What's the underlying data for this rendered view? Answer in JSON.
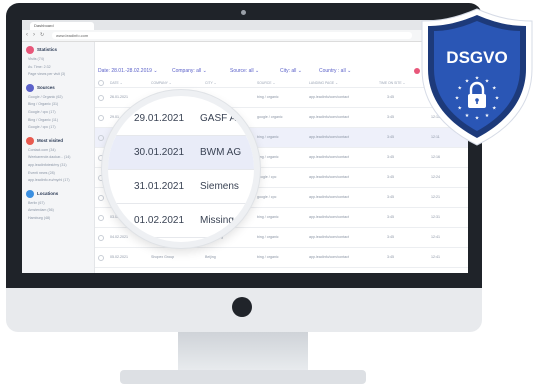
{
  "browser": {
    "tab_title": "Dashboard",
    "url": "www.leadinfo.com",
    "nav_back": "‹",
    "nav_forward": "›",
    "nav_reload": "↻"
  },
  "sidebar": {
    "sections": [
      {
        "title": "Statistics",
        "color": "#e8577a",
        "items": [
          "Visits (74)",
          "Av. Time: 2:32",
          "Page views per visit (3)"
        ]
      },
      {
        "title": "Sources",
        "color": "#5b61c9",
        "items": [
          "Google / Organic (62)",
          "Bing / Organic (31)",
          "Google / cpc (17)",
          "Bing / Organic (11)",
          "Google / cpc (17)"
        ]
      },
      {
        "title": "Most visited",
        "color": "#e85a4f",
        "items": [
          "Contact.com (34)",
          "Weekarende.daokar... (14)",
          "app.leadinfotest/my (31)",
          "Eventi news (28)",
          "app.leadinfo.eu/my/nl (17)"
        ]
      },
      {
        "title": "Locations",
        "color": "#3b8fe0",
        "items": [
          "Berlin (67)",
          "Amsterdam (56)",
          "Hamburg (48)"
        ]
      }
    ]
  },
  "filters": {
    "date": "Date: 28.01.-28.02.2019 ⌄",
    "company": "Company: all ⌄",
    "source": "Source: all ⌄",
    "city": "City: all ⌄",
    "country": "Country : all ⌄"
  },
  "table": {
    "headers": [
      "DATE ⌄",
      "COMPANY ⌄",
      "CITY ⌄",
      "SOURCE ⌄",
      "LANDING PAGE ⌄",
      "TIME ON SITE ⌄",
      "PAGES"
    ],
    "rows": [
      {
        "date": "26.01.2021",
        "company": "",
        "city": "",
        "source": "bing / organic",
        "page": "app.leadinfo/com/contact",
        "time": "3:45",
        "pages": "12:11"
      },
      {
        "date": "29.01",
        "company": "",
        "city": "",
        "source": "google / organic",
        "page": "app.leadinfo/com/contact",
        "time": "3:45",
        "pages": "12:15"
      },
      {
        "date": "",
        "company": "",
        "city": "",
        "source": "bing / organic",
        "page": "app.leadinfo/com/contact",
        "time": "3:45",
        "pages": "12:11"
      },
      {
        "date": "",
        "company": "",
        "city": "",
        "source": "bing / organic",
        "page": "app.leadinfo/com/contact",
        "time": "3:45",
        "pages": "12:16"
      },
      {
        "date": "",
        "company": "",
        "city": "",
        "source": "google / cpc",
        "page": "app.leadinfo/com/contact",
        "time": "3:45",
        "pages": "12:24"
      },
      {
        "date": "02.02",
        "company": "",
        "city": "",
        "source": "google / cpc",
        "page": "app.leadinfo/com/contact",
        "time": "3:45",
        "pages": "12:21"
      },
      {
        "date": "03.02.2021",
        "company": "",
        "city": "",
        "source": "bing / organic",
        "page": "app.leadinfo/com/contact",
        "time": "3:45",
        "pages": "12:31"
      },
      {
        "date": "04.02.2021",
        "company": "Kerig & clothes",
        "city": "Hong Kong",
        "source": "bing / organic",
        "page": "app.leadinfo/com/contact",
        "time": "3:45",
        "pages": "12:41"
      },
      {
        "date": "05.02.2021",
        "company": "Shopex Group",
        "city": "Beijing",
        "source": "bing / organic",
        "page": "app.leadinfo/com/contact",
        "time": "3:45",
        "pages": "12:41"
      }
    ]
  },
  "magnifier": {
    "rows": [
      {
        "date": "29.01.2021",
        "company": "GASF AG"
      },
      {
        "date": "30.01.2021",
        "company": "BWM AG"
      },
      {
        "date": "31.01.2021",
        "company": "Siemens"
      },
      {
        "date": "01.02.2021",
        "company": "Missing"
      }
    ],
    "highlight_index": 1
  },
  "badge": {
    "text": "DSGVO",
    "colors": {
      "outer": "#1d3a7a",
      "inner": "#2a56b5",
      "rim": "#ffffff"
    }
  }
}
